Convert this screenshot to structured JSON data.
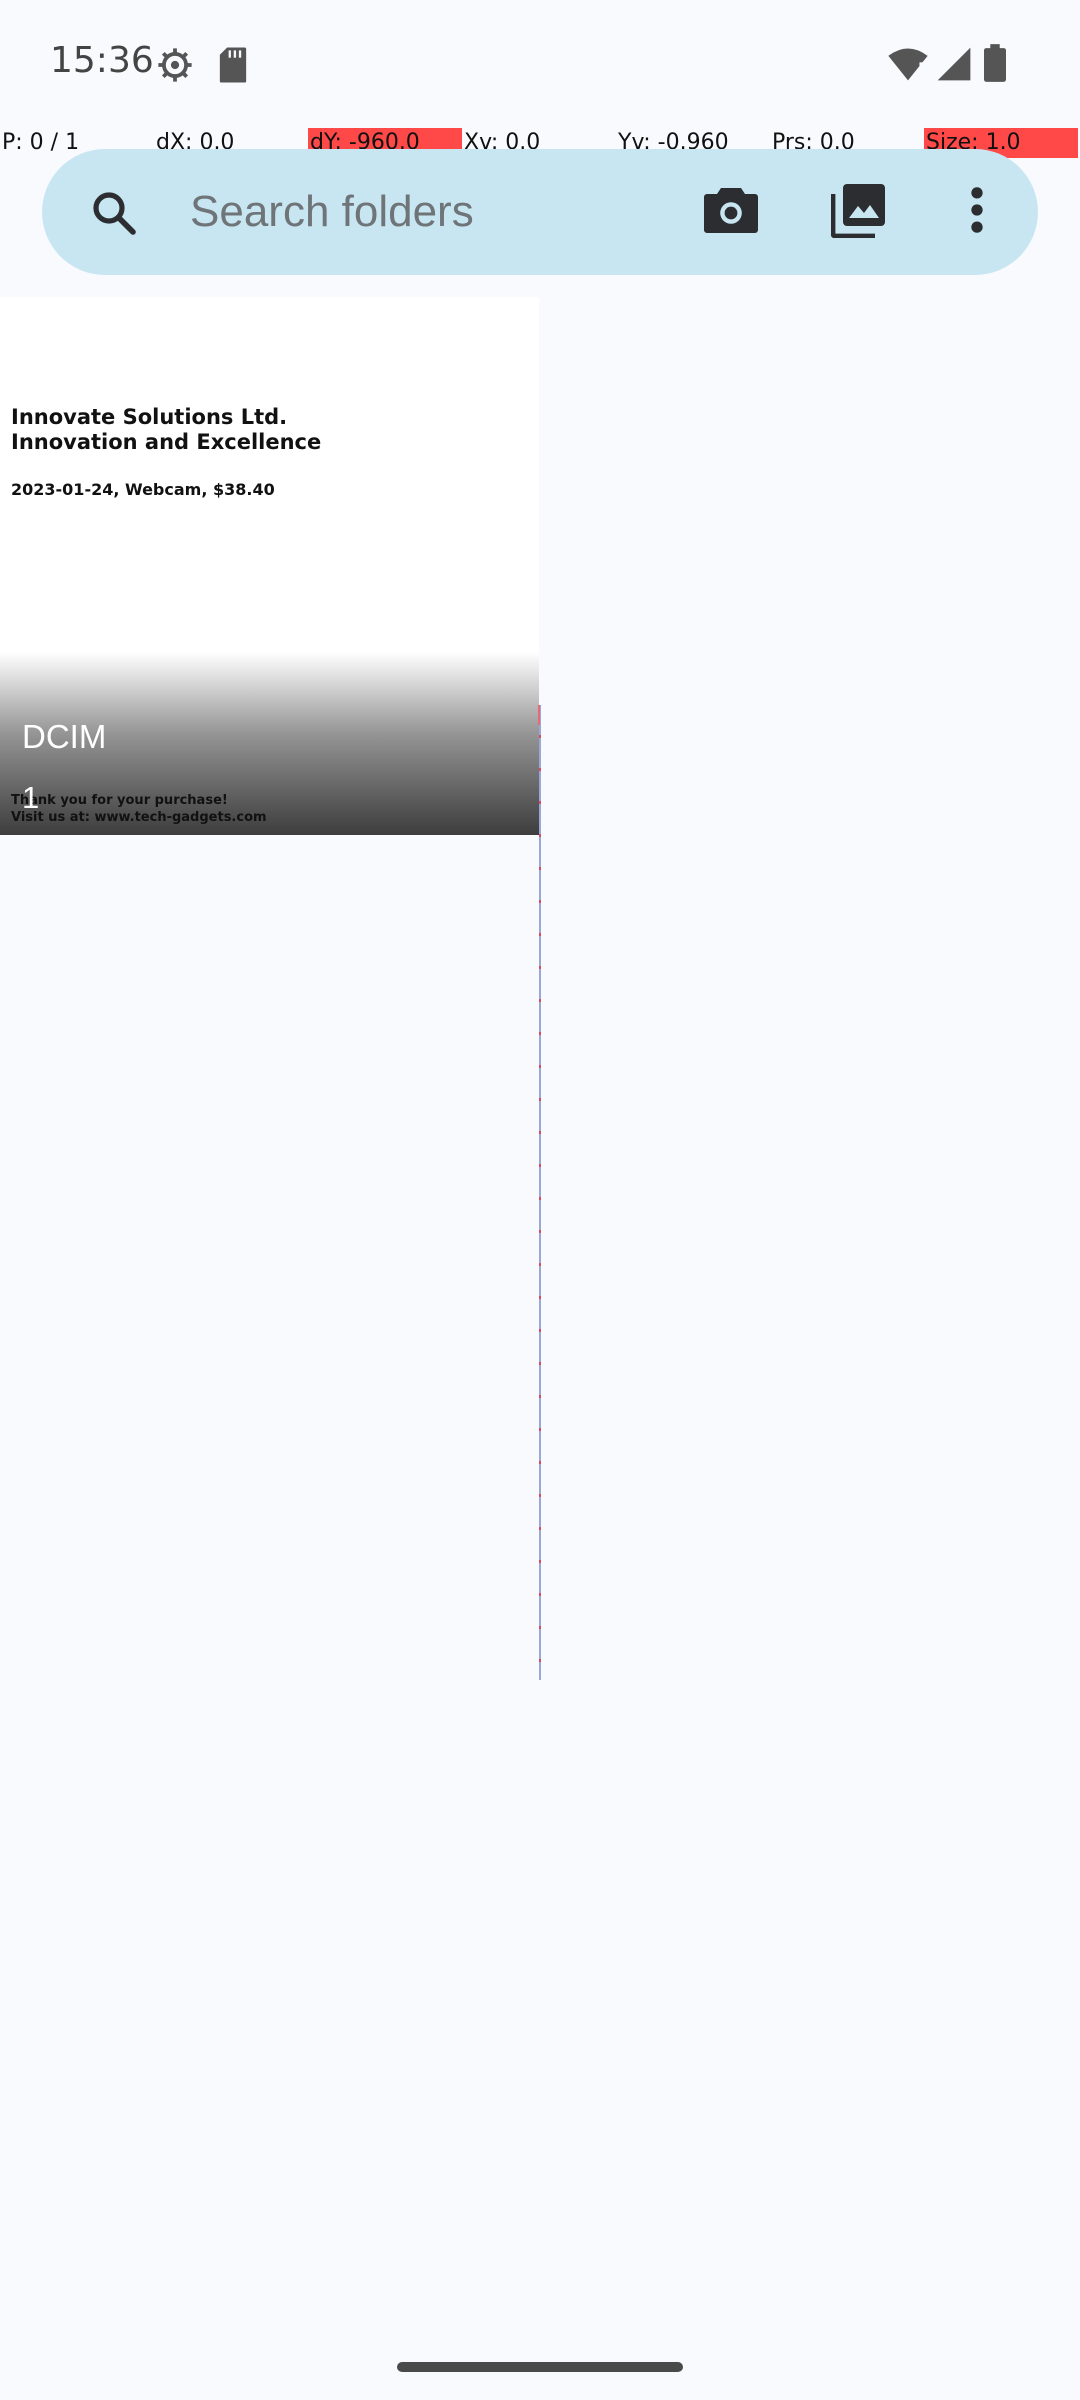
{
  "status_bar": {
    "time": "15:36",
    "icons": [
      "settings-gear-icon",
      "sd-card-icon",
      "wifi-alert-icon",
      "cell-signal-icon",
      "battery-icon"
    ]
  },
  "pointer_location": {
    "p": "P: 0 / 1",
    "dx": "dX: 0.0",
    "dy": "dY: -960.0",
    "xv": "Xv: 0.0",
    "yv": "Yv: -0.960",
    "prs": "Prs: 0.0",
    "size": "Size: 1.0"
  },
  "search": {
    "placeholder": "Search folders",
    "actions": [
      "camera-icon",
      "photo-library-icon",
      "more-options-icon"
    ]
  },
  "folders": [
    {
      "name": "DCIM",
      "count": "1",
      "thumbnail": {
        "company_line1": "Innovate Solutions Ltd.",
        "company_line2": "Innovation and Excellence",
        "line": "2023-01-24, Webcam, $38.40",
        "footer_line1": "Thank you for your purchase!",
        "footer_line2": "Visit us at: www.tech-gadgets.com"
      }
    }
  ]
}
